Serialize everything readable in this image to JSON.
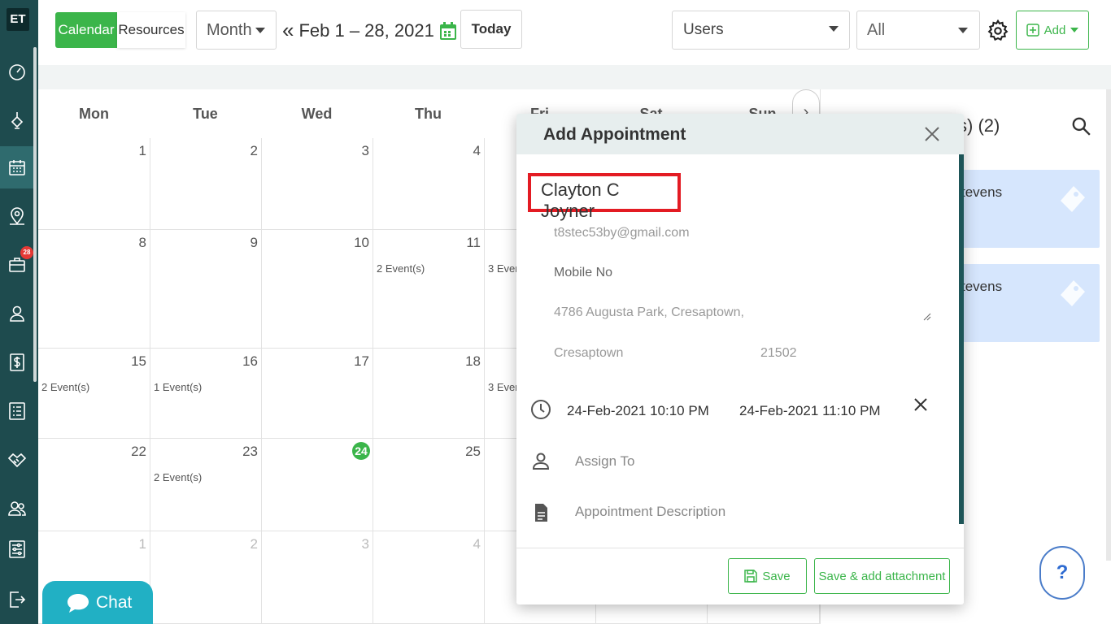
{
  "app": {
    "logo": "ET"
  },
  "sidebar": {
    "items": [
      {
        "icon": "dashboard-icon"
      },
      {
        "icon": "pen-tool-icon"
      },
      {
        "icon": "calendar-icon",
        "active": true
      },
      {
        "icon": "map-pin-icon"
      },
      {
        "icon": "briefcase-icon",
        "badge": "28"
      },
      {
        "icon": "user-icon"
      },
      {
        "icon": "dollar-icon"
      },
      {
        "icon": "list-icon"
      },
      {
        "icon": "handshake-icon"
      },
      {
        "icon": "users-icon"
      },
      {
        "icon": "sliders-icon"
      },
      {
        "icon": "logout-icon"
      }
    ]
  },
  "toolbar": {
    "calendar_label": "Calendar",
    "resources_label": "Resources",
    "view_value": "Month",
    "range_prev": "«",
    "range_text": "Feb 1 – 28, 2021",
    "range_next": "»",
    "today_label": "Today",
    "users_value": "Users",
    "all_value": "All",
    "add_label": "Add"
  },
  "calendar": {
    "days_of_week": [
      "Mon",
      "Tue",
      "Wed",
      "Thu",
      "Fri",
      "Sat",
      "Sun"
    ],
    "weeks": [
      [
        {
          "num": "1"
        },
        {
          "num": "2"
        },
        {
          "num": "3"
        },
        {
          "num": "4"
        }
      ],
      [
        {
          "num": "8"
        },
        {
          "num": "9"
        },
        {
          "num": "10"
        },
        {
          "num": "11",
          "events": "2 Event(s)"
        },
        {
          "events": "3 Even"
        }
      ],
      [
        {
          "num": "15",
          "events": "2 Event(s)"
        },
        {
          "num": "16",
          "events": "1 Event(s)"
        },
        {
          "num": "17"
        },
        {
          "num": "18"
        },
        {
          "events": "3 Even"
        }
      ],
      [
        {
          "num": "22"
        },
        {
          "num": "23",
          "events": "2 Event(s)"
        },
        {
          "num": "24",
          "today": true
        },
        {
          "num": "25"
        }
      ],
      [
        {
          "num": "1",
          "muted": true
        },
        {
          "num": "2",
          "muted": true
        },
        {
          "num": "3",
          "muted": true
        },
        {
          "num": "4",
          "muted": true
        }
      ]
    ],
    "next_arrow": "›"
  },
  "right_panel": {
    "title": "s) (2)",
    "cards": [
      {
        "name": "tevens"
      },
      {
        "name": "tevens"
      }
    ],
    "help_label": "?"
  },
  "chat": {
    "label": "Chat"
  },
  "modal": {
    "title": "Add Appointment",
    "client_name": "Clayton C Joyner",
    "email": "t8stec53by@gmail.com",
    "mobile_placeholder": "Mobile No",
    "address": "4786  Augusta Park, Cresaptown,",
    "city": "Cresaptown",
    "zip": "21502",
    "start": "24-Feb-2021 10:10 PM",
    "end": "24-Feb-2021 11:10 PM",
    "assign_placeholder": "Assign To",
    "description_placeholder": "Appointment Description",
    "save_label": "Save",
    "save_attach_label": "Save & add attachment"
  },
  "colors": {
    "sidebar": "#1e4b4e",
    "accent_green": "#3bb54a",
    "highlight_red": "#e31b23",
    "chat": "#21b0c4",
    "event_card": "#d6e6fd"
  }
}
